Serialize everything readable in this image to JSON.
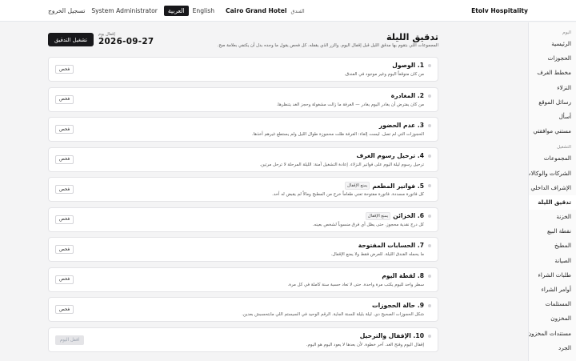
{
  "topbar": {
    "brand": "Etolv Hospitality",
    "hotel_label": "الفندق",
    "hotel_name": "Cairo Grand Hotel",
    "lang_en": "English",
    "lang_ar": "العربية",
    "user": "System Administrator",
    "logout": "تسجيل الخروج"
  },
  "sidebar": {
    "sections": [
      {
        "title": "اليوم",
        "items": [
          "الرئيسية",
          "الحجوزات",
          "مخطط الغرف",
          "النزلاء",
          "رسائل الموقع",
          "أسأل",
          "مستني موافقتي"
        ]
      },
      {
        "title": "التشغيل",
        "items": [
          "المجموعات",
          "الشركات والوكالات",
          "الإشراف الداخلي",
          "تدقيق الليلة",
          "الخزنة",
          "نقطة البيع",
          "المطبخ",
          "الصيانة",
          "طلبات الشراء",
          "أوامر الشراء",
          "المستلمات",
          "المخزون",
          "مستندات المخزون",
          "الجرد"
        ]
      }
    ],
    "active": "تدقيق الليلة"
  },
  "page": {
    "title": "تدقيق الليلة",
    "subtitle": "المجموعات اللي بتقوم بها مدقق الليل قبل إقفال اليوم. والزر الذي يقفله. كل فحص يقول ما وجده بدل أن يكتفي بعلامة صح.",
    "date_label": "إقفال يوم",
    "date_value": "2026-09-27",
    "start_button": "تشغيل التدقيق"
  },
  "steps": [
    {
      "num": "1.",
      "title": "الوصول",
      "badge": "",
      "desc": "من كان متوقعاً اليوم وغير موجود في الفندق.",
      "action": "فحص"
    },
    {
      "num": "2.",
      "title": "المغادرة",
      "badge": "",
      "desc": "من كان يفترض أن يغادر اليوم يغادر — الغرفة ما زالت مشغولة وحجز الغد يتنظرها.",
      "action": "فحص"
    },
    {
      "num": "3.",
      "title": "عدم الحضور",
      "badge": "",
      "desc": "الحجوزات التي لم تصل. ليست إلغاء: الغرفة ظلت محجوزة طوال الليل ولم يستطع غيرهم أخذها.",
      "action": "فحص"
    },
    {
      "num": "4.",
      "title": "ترحيل رسوم الغرف",
      "badge": "",
      "desc": "ترحيل رسوم ليلة اليوم على فواتير النزلاء. إعادة التشغيل آمنة: الليلة المرحلة لا ترحل مرتين.",
      "action": "فحص"
    },
    {
      "num": "5.",
      "title": "فواتير المطعم",
      "badge": "يمنع الإقفال",
      "desc": "كل فاتورة مسددة. فاتورة مفتوحة تعني طعاماً خرج من المطبخ ومالاً لم يقبض له أحد.",
      "action": "فحص"
    },
    {
      "num": "6.",
      "title": "الخزائن",
      "badge": "يمنع الإقفال",
      "desc": "كل درج نقدية محجوز. حتى يظل أي فرق منسوباً لشخص بعينه.",
      "action": "فحص"
    },
    {
      "num": "7.",
      "title": "الحسابات المفتوحة",
      "badge": "",
      "desc": "ما يحمله الفندق الليلة. للعرض فقط ولا يمنع الإقفال.",
      "action": "فحص"
    },
    {
      "num": "8.",
      "title": "لقطة اليوم",
      "badge": "",
      "desc": "سطر واحد لليوم يكتب مرة واحدة. حتى لا تعاد حسبة سنة كاملة في كل مرة.",
      "action": "فحص"
    },
    {
      "num": "9.",
      "title": "حالة الحجوزات",
      "badge": "",
      "desc": "شكل الحجوزات الصحيح دي. ليلة بليلة للسنة الجاية. الرقم الوحيد في السيستم اللي مابتحسبش بعدين.",
      "action": "فحص"
    },
    {
      "num": "10.",
      "title": "الإقفال والترحيل",
      "badge": "",
      "desc": "إقفال اليوم وفتح الغد. آخر خطوة. لأن بعدها لا يعود اليوم هو اليوم.",
      "action": "اقفل اليوم"
    }
  ],
  "colors": {
    "primary": "#18181b",
    "background": "#f4f4f5",
    "card": "#ffffff",
    "border": "#e4e4e7"
  }
}
